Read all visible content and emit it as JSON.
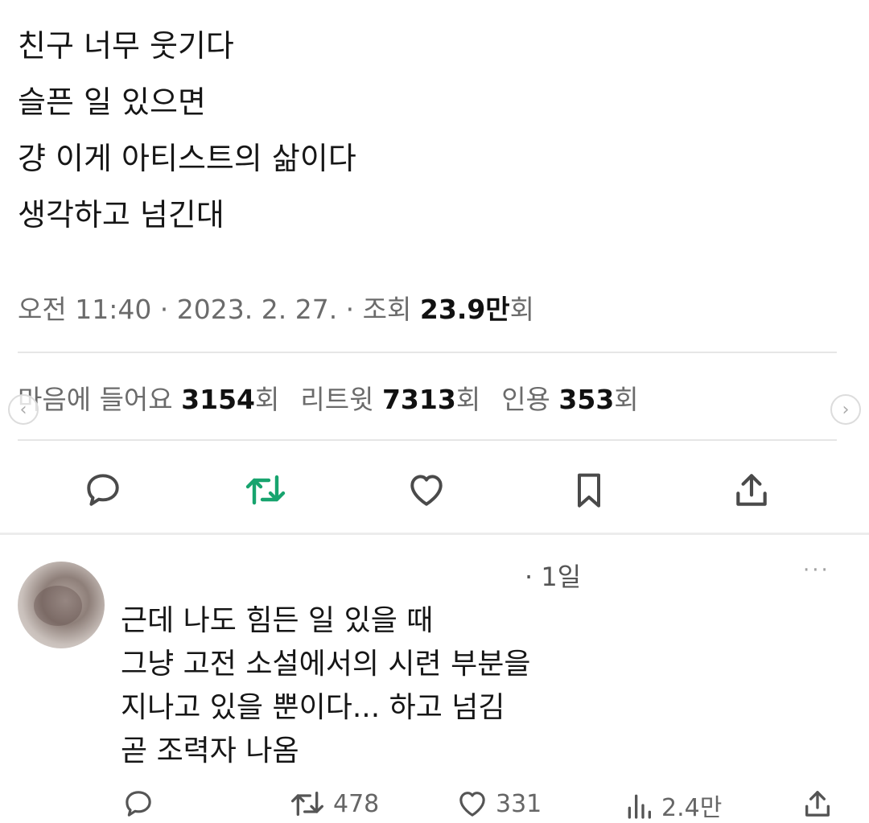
{
  "tweet": {
    "lines": [
      "친구 너무 웃기다",
      "슬픈 일 있으면",
      "걍 이게 아티스트의 삶이다",
      "생각하고 넘긴대"
    ],
    "meta_prefix": "오전 11:40 · 2023. 2. 27. · 조회 ",
    "views_value": "23.9만",
    "views_suffix": "회"
  },
  "stats": {
    "likes_label": "마음에 들어요 ",
    "likes_value": "3154",
    "likes_suffix": "회",
    "retweets_label": "리트윗 ",
    "retweets_value": "7313",
    "retweets_suffix": "회",
    "quotes_label": "인용 ",
    "quotes_value": "353",
    "quotes_suffix": "회"
  },
  "carousel": {
    "prev_icon": "chevron-left-icon",
    "next_icon": "chevron-right-icon"
  },
  "actions": {
    "reply_icon": "reply-icon",
    "retweet_icon": "retweet-icon",
    "like_icon": "heart-icon",
    "bookmark_icon": "bookmark-icon",
    "share_icon": "share-icon",
    "retweet_color": "#17a46e",
    "icon_color": "#4a4a4a"
  },
  "reply": {
    "time": "· 1일",
    "more": "···",
    "lines": [
      "근데 나도 힘든 일 있을 때",
      "그냥 고전 소설에서의 시련 부분을",
      "지나고 있을 뿐이다... 하고 넘김",
      "곧 조력자 나옴"
    ],
    "retweet_count": "478",
    "like_count": "331",
    "views_count": "2.4만"
  }
}
